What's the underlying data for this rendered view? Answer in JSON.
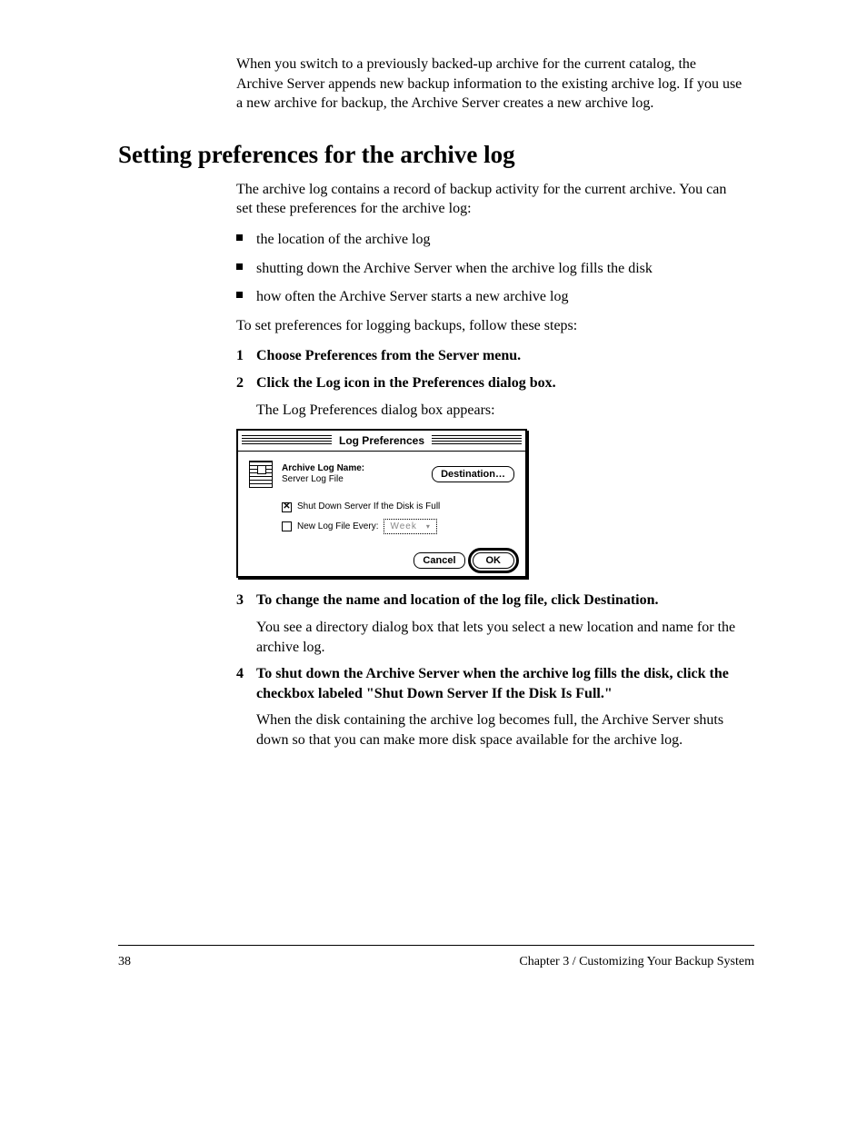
{
  "intro": {
    "p1": "When you switch to a previously backed-up archive for the current catalog, the Archive Server appends new backup information to the existing archive log. If you use a new archive for backup, the Archive Server creates a new archive log."
  },
  "section_title": "Setting preferences for the archive log",
  "body": {
    "p1": "The archive log contains a record of backup activity for the current archive. You can set these preferences for the archive log:",
    "bullets": [
      "the location of the archive log",
      "shutting down the Archive Server when the archive log fills the disk",
      "how often the Archive Server starts a new archive log"
    ],
    "p2": "To set preferences for logging backups, follow these steps:",
    "steps": [
      {
        "n": "1",
        "text": "Choose Preferences from the Server menu.",
        "bold": true
      },
      {
        "n": "2",
        "text": "Click the Log icon in the Preferences dialog box.",
        "bold": true
      },
      {
        "n": "",
        "text": "The Log Preferences dialog box appears:",
        "bold": false
      }
    ],
    "after_dialog": [
      {
        "n": "3",
        "text": "To change the name and location of the log file, click Destination.",
        "bold": true
      },
      {
        "n": "",
        "text": "You see a directory dialog box that lets you select a new location and name for the archive log.",
        "bold": false
      },
      {
        "n": "4",
        "text": "To shut down the Archive Server when the archive log fills the disk, click the checkbox labeled \"Shut Down Server If the Disk Is Full.\"",
        "bold": true
      },
      {
        "n": "",
        "text": "When the disk containing the archive log becomes full, the Archive Server shuts down so that you can make more disk space available for the archive log.",
        "bold": false
      }
    ]
  },
  "dialog": {
    "title": "Log Preferences",
    "archive_label": "Archive Log Name:",
    "archive_value": "Server Log File",
    "destination_btn": "Destination…",
    "opt_shutdown": "Shut Down Server If the Disk is Full",
    "opt_newlog": "New Log File Every:",
    "popup_value": "Week",
    "cancel": "Cancel",
    "ok": "OK"
  },
  "footer": {
    "page": "38",
    "chapter": "Chapter 3 / Customizing Your Backup System"
  }
}
